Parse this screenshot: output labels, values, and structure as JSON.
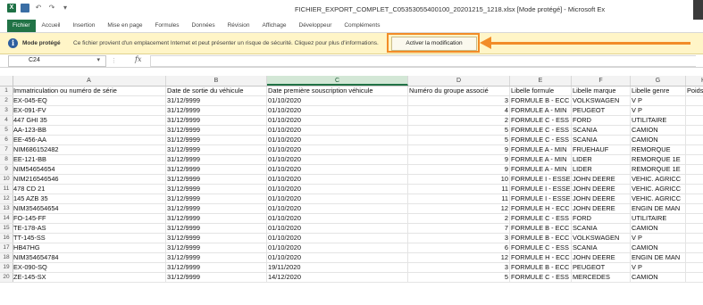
{
  "window": {
    "title": "FICHIER_EXPORT_COMPLET_C05353055400100_20201215_1218.xlsx  [Mode protégé] - Microsoft Ex",
    "app_icon": "X"
  },
  "ribbon": {
    "tabs": [
      "Fichier",
      "Accueil",
      "Insertion",
      "Mise en page",
      "Formules",
      "Données",
      "Révision",
      "Affichage",
      "Développeur",
      "Compléments"
    ]
  },
  "protected_bar": {
    "title": "Mode protégé",
    "message": "Ce fichier provient d'un emplacement Internet et peut présenter un risque de sécurité. Cliquez pour plus d'informations.",
    "button_label": "Activer la modification",
    "accent_color": "#f28c28"
  },
  "formula_bar": {
    "name_box": "C24",
    "fx_label": "fx",
    "formula": ""
  },
  "sheet": {
    "columns": [
      "A",
      "B",
      "C",
      "D",
      "E",
      "F",
      "G",
      "H"
    ],
    "selected_column": "C",
    "header_row": {
      "num": "1",
      "cells": [
        "Immatriculation ou numéro de série",
        "Date de sortie du véhicule",
        "Date première souscription véhicule",
        "Numéro du groupe associé",
        "Libelle formule",
        "Libelle marque",
        "Libelle genre",
        "Poids"
      ]
    },
    "rows": [
      {
        "num": "2",
        "cells": [
          "EX-045-EQ",
          "31/12/9999",
          "01/10/2020",
          "3",
          "FORMULE B - ECC",
          "VOLKSWAGEN",
          "V P",
          ""
        ]
      },
      {
        "num": "3",
        "cells": [
          "EX-091-FV",
          "31/12/9999",
          "01/10/2020",
          "4",
          "FORMULE A - MIN",
          "PEUGEOT",
          "V P",
          ""
        ]
      },
      {
        "num": "4",
        "cells": [
          "447 GHI 35",
          "31/12/9999",
          "01/10/2020",
          "2",
          "FORMULE C - ESS",
          "FORD",
          "UTILITAIRE",
          ""
        ]
      },
      {
        "num": "5",
        "cells": [
          "AA-123-BB",
          "31/12/9999",
          "01/10/2020",
          "5",
          "FORMULE C - ESS",
          "SCANIA",
          "CAMION",
          ""
        ]
      },
      {
        "num": "6",
        "cells": [
          "EE-456-AA",
          "31/12/9999",
          "01/10/2020",
          "5",
          "FORMULE C - ESS",
          "SCANIA",
          "CAMION",
          ""
        ]
      },
      {
        "num": "7",
        "cells": [
          "NIM686152482",
          "31/12/9999",
          "01/10/2020",
          "9",
          "FORMULE A - MIN",
          "FRUEHAUF",
          "REMORQUE",
          ""
        ]
      },
      {
        "num": "8",
        "cells": [
          "EE-121-BB",
          "31/12/9999",
          "01/10/2020",
          "9",
          "FORMULE A - MIN",
          "LIDER",
          "REMORQUE 1E",
          ""
        ]
      },
      {
        "num": "9",
        "cells": [
          "NIM54654654",
          "31/12/9999",
          "01/10/2020",
          "9",
          "FORMULE A - MIN",
          "LIDER",
          "REMORQUE 1E",
          ""
        ]
      },
      {
        "num": "10",
        "cells": [
          "NIM216546546",
          "31/12/9999",
          "01/10/2020",
          "10",
          "FORMULE I - ESSE",
          "JOHN DEERE",
          "VEHIC. AGRICC",
          ""
        ]
      },
      {
        "num": "11",
        "cells": [
          "478 CD 21",
          "31/12/9999",
          "01/10/2020",
          "11",
          "FORMULE I - ESSE",
          "JOHN DEERE",
          "VEHIC. AGRICC",
          ""
        ]
      },
      {
        "num": "12",
        "cells": [
          "145 AZB 35",
          "31/12/9999",
          "01/10/2020",
          "11",
          "FORMULE I - ESSE",
          "JOHN DEERE",
          "VEHIC. AGRICC",
          ""
        ]
      },
      {
        "num": "13",
        "cells": [
          "NIM354654654",
          "31/12/9999",
          "01/10/2020",
          "12",
          "FORMULE H - ECC",
          "JOHN DEERE",
          "ENGIN DE MAN",
          ""
        ]
      },
      {
        "num": "14",
        "cells": [
          "FO-145-FF",
          "31/12/9999",
          "01/10/2020",
          "2",
          "FORMULE C - ESS",
          "FORD",
          "UTILITAIRE",
          ""
        ]
      },
      {
        "num": "15",
        "cells": [
          "TE-178-AS",
          "31/12/9999",
          "01/10/2020",
          "7",
          "FORMULE B - ECC",
          "SCANIA",
          "CAMION",
          ""
        ]
      },
      {
        "num": "16",
        "cells": [
          "TT-145-SS",
          "31/12/9999",
          "01/10/2020",
          "3",
          "FORMULE B - ECC",
          "VOLKSWAGEN",
          "V P",
          ""
        ]
      },
      {
        "num": "17",
        "cells": [
          "HB47HG",
          "31/12/9999",
          "01/10/2020",
          "6",
          "FORMULE C - ESS",
          "SCANIA",
          "CAMION",
          ""
        ]
      },
      {
        "num": "18",
        "cells": [
          "NIM354654784",
          "31/12/9999",
          "01/10/2020",
          "12",
          "FORMULE H - ECC",
          "JOHN DEERE",
          "ENGIN DE MAN",
          ""
        ]
      },
      {
        "num": "19",
        "cells": [
          "EX-090-SQ",
          "31/12/9999",
          "19/11/2020",
          "3",
          "FORMULE B - ECC",
          "PEUGEOT",
          "V P",
          ""
        ]
      },
      {
        "num": "20",
        "cells": [
          "ZE-145-SX",
          "31/12/9999",
          "14/12/2020",
          "5",
          "FORMULE C - ESS",
          "MERCEDES",
          "CAMION",
          ""
        ]
      }
    ]
  }
}
